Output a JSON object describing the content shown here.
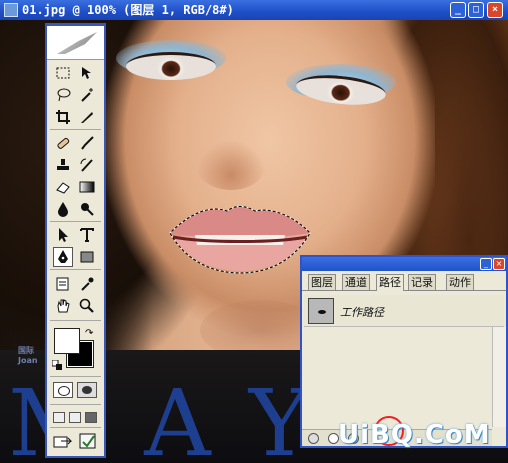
{
  "window": {
    "title": "01.jpg @ 100% (图层 1, RGB/8#)",
    "minimize_icon": "minimize-icon",
    "maximize_icon": "maximize-icon",
    "close_icon": "close-icon"
  },
  "canvas": {
    "big_text": "MAY",
    "side_text_line1": "国际",
    "side_text_line2": "Joan"
  },
  "toolbox": {
    "tools": [
      "rectangular-marquee-icon",
      "move-icon",
      "lasso-icon",
      "magic-wand-icon",
      "crop-icon",
      "slice-icon",
      "healing-brush-icon",
      "brush-icon",
      "clone-stamp-icon",
      "history-brush-icon",
      "eraser-icon",
      "gradient-icon",
      "blur-icon",
      "dodge-icon",
      "path-selection-icon",
      "type-icon",
      "pen-icon",
      "rectangle-shape-icon",
      "notes-icon",
      "eyedropper-icon",
      "hand-icon",
      "zoom-icon"
    ],
    "selected_tool": "pen-icon",
    "foreground_color": "#ffffff",
    "background_color": "#000000"
  },
  "paths_panel": {
    "tabs": [
      "图层",
      "通道",
      "路径",
      "记录",
      "动作"
    ],
    "active_tab": "路径",
    "path_items": [
      {
        "name": "工作路径"
      }
    ]
  },
  "watermark": {
    "text": "UiBQ.CoM"
  }
}
